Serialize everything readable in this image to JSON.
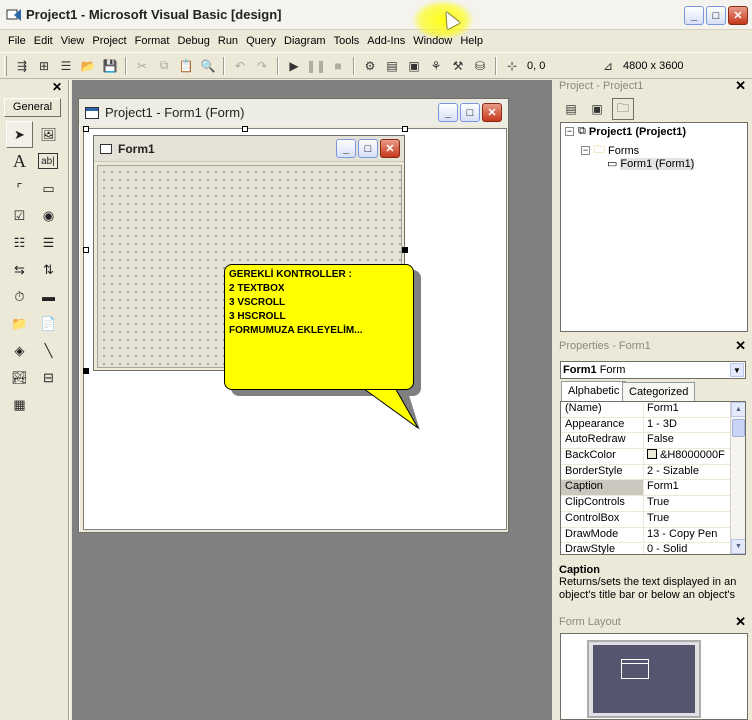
{
  "window": {
    "title": "Project1 - Microsoft Visual Basic [design]",
    "min": "_",
    "max": "□",
    "close": "✕"
  },
  "menu": [
    "File",
    "Edit",
    "View",
    "Project",
    "Format",
    "Debug",
    "Run",
    "Query",
    "Diagram",
    "Tools",
    "Add-Ins",
    "Window",
    "Help"
  ],
  "toolbar": {
    "position": "0, 0",
    "size": "4800 x 3600"
  },
  "toolbox": {
    "close": "✕",
    "tab": "General"
  },
  "designer": {
    "title": "Project1 - Form1 (Form)",
    "form_title": "Form1"
  },
  "callout": {
    "lines": [
      "GEREKLİ KONTROLLER :",
      "2 TEXTBOX",
      "3 VSCROLL",
      "3 HSCROLL",
      "FORMUMUZA EKLEYELİM..."
    ],
    "fill": "#FFFF00"
  },
  "project_explorer": {
    "title": "Project - Project1",
    "close": "✕",
    "root": "Project1 (Project1)",
    "folder": "Forms",
    "item": "Form1 (Form1)"
  },
  "properties": {
    "title": "Properties - Form1",
    "close": "✕",
    "object": "Form1",
    "object_type": "Form",
    "tabs": [
      "Alphabetic",
      "Categorized"
    ],
    "rows": [
      {
        "name": "(Name)",
        "value": "Form1"
      },
      {
        "name": "Appearance",
        "value": "1 - 3D"
      },
      {
        "name": "AutoRedraw",
        "value": "False"
      },
      {
        "name": "BackColor",
        "value": "&H8000000F"
      },
      {
        "name": "BorderStyle",
        "value": "2 - Sizable"
      },
      {
        "name": "Caption",
        "value": "Form1"
      },
      {
        "name": "ClipControls",
        "value": "True"
      },
      {
        "name": "ControlBox",
        "value": "True"
      },
      {
        "name": "DrawMode",
        "value": "13 - Copy Pen"
      },
      {
        "name": "DrawStyle",
        "value": "0 - Solid"
      }
    ],
    "desc_title": "Caption",
    "desc_text": "Returns/sets the text displayed in an object's title bar or below an object's"
  },
  "form_layout": {
    "title": "Form Layout",
    "close": "✕"
  }
}
